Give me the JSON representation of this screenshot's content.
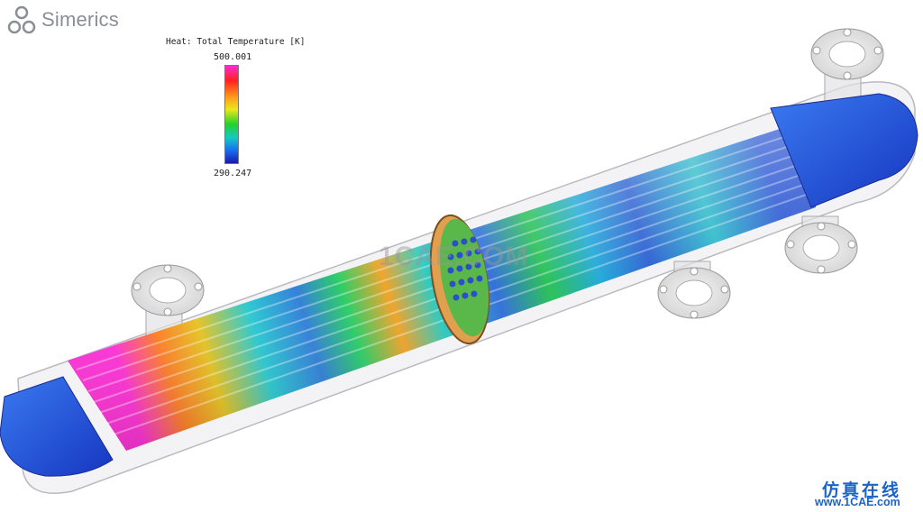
{
  "brand": {
    "logo_text": "Simerics"
  },
  "legend": {
    "title": "Heat: Total Temperature [K]",
    "max_label": "500.001",
    "min_label": "290.247"
  },
  "watermark": {
    "text": "1CAE.COM"
  },
  "site": {
    "name_cn": "仿真在线",
    "url": "www.1CAE.com"
  },
  "colors": {
    "hot": "#ff2bd6",
    "warm": "#ff9a1a",
    "mid": "#22d22a",
    "cool": "#14c8c8",
    "cold": "#1a3ad0",
    "site_blue": "#1c63c9"
  }
}
